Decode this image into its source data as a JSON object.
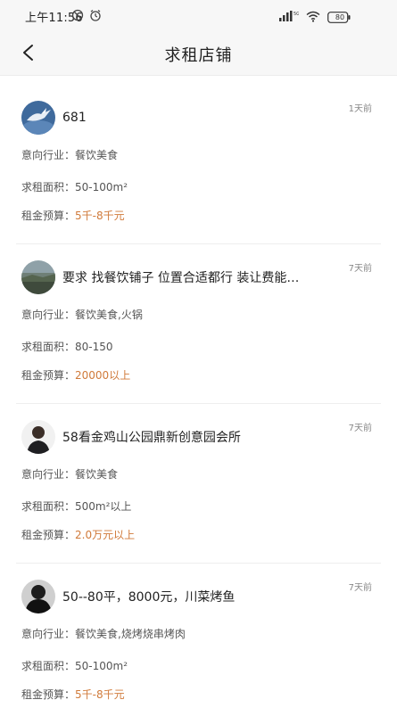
{
  "status_bar": {
    "time": "上午11:56",
    "battery": "80"
  },
  "nav": {
    "title": "求租店铺"
  },
  "labels": {
    "industry": "意向行业：",
    "area": "求租面积：",
    "budget": "租金预算："
  },
  "listings": [
    {
      "title": "681",
      "time": "1天前",
      "industry": "餐饮美食",
      "area": "50-100m²",
      "budget": "5千-8千元"
    },
    {
      "title": "要求 找餐饮铺子 位置合适都行 装让费能…",
      "time": "7天前",
      "industry": "餐饮美食,火锅",
      "area": "80-150",
      "budget": "20000以上"
    },
    {
      "title": "58看金鸡山公园鼎新创意园会所",
      "time": "7天前",
      "industry": "餐饮美食",
      "area": "500m²以上",
      "budget": "2.0万元以上"
    },
    {
      "title": "50--80平，8000元，川菜烤鱼",
      "time": "7天前",
      "industry": "餐饮美食,烧烤烧串烤肉",
      "area": "50-100m²",
      "budget": "5千-8千元"
    }
  ]
}
